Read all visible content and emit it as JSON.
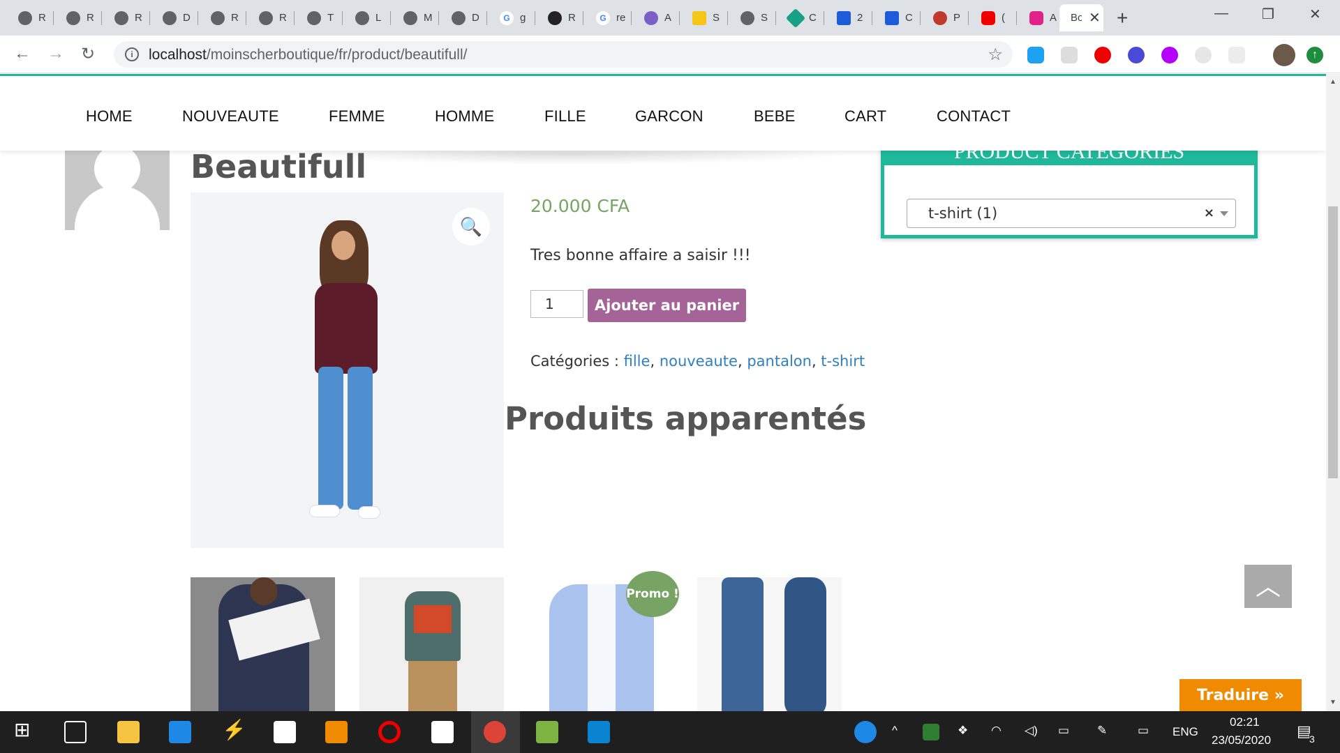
{
  "browser": {
    "tabs": [
      {
        "label": "R"
      },
      {
        "label": "R"
      },
      {
        "label": "R"
      },
      {
        "label": "D"
      },
      {
        "label": "R"
      },
      {
        "label": "R"
      },
      {
        "label": "T"
      },
      {
        "label": "L"
      },
      {
        "label": "M"
      },
      {
        "label": "D"
      },
      {
        "label": "g"
      },
      {
        "label": "R"
      },
      {
        "label": "re"
      },
      {
        "label": "A"
      },
      {
        "label": "S"
      },
      {
        "label": "S"
      },
      {
        "label": "C"
      },
      {
        "label": "2"
      },
      {
        "label": "C"
      },
      {
        "label": "P"
      },
      {
        "label": "("
      },
      {
        "label": "A"
      }
    ],
    "active_tab": "Bo",
    "url_host": "localhost",
    "url_path": "/moinscherboutique/fr/product/beautifull/"
  },
  "menu": [
    "HOME",
    "NOUVEAUTE",
    "FEMME",
    "HOMME",
    "FILLE",
    "GARCON",
    "BEBE",
    "CART",
    "CONTACT"
  ],
  "product": {
    "title": "Beautifull",
    "price": "20.000 CFA",
    "description": "Tres bonne affaire a saisir !!!",
    "quantity": "1",
    "add_to_cart": "Ajouter au panier",
    "categories_label": "Catégories : ",
    "categories": [
      "fille",
      "nouveaute",
      "pantalon",
      "t-shirt"
    ]
  },
  "related": {
    "title": "Produits apparentés",
    "promo_badge": "Promo !"
  },
  "widget": {
    "title": "PRODUCT CATEGORIES",
    "selected": "t-shirt  (1)",
    "clear": "×"
  },
  "translate_button": "Traduire »",
  "taskbar": {
    "language": "ENG",
    "time": "02:21",
    "date": "23/05/2020",
    "notifications": "3"
  },
  "colors": {
    "accent": "#1fb89a",
    "price": "#77a464",
    "button": "#a46497",
    "translate": "#f08a00"
  }
}
